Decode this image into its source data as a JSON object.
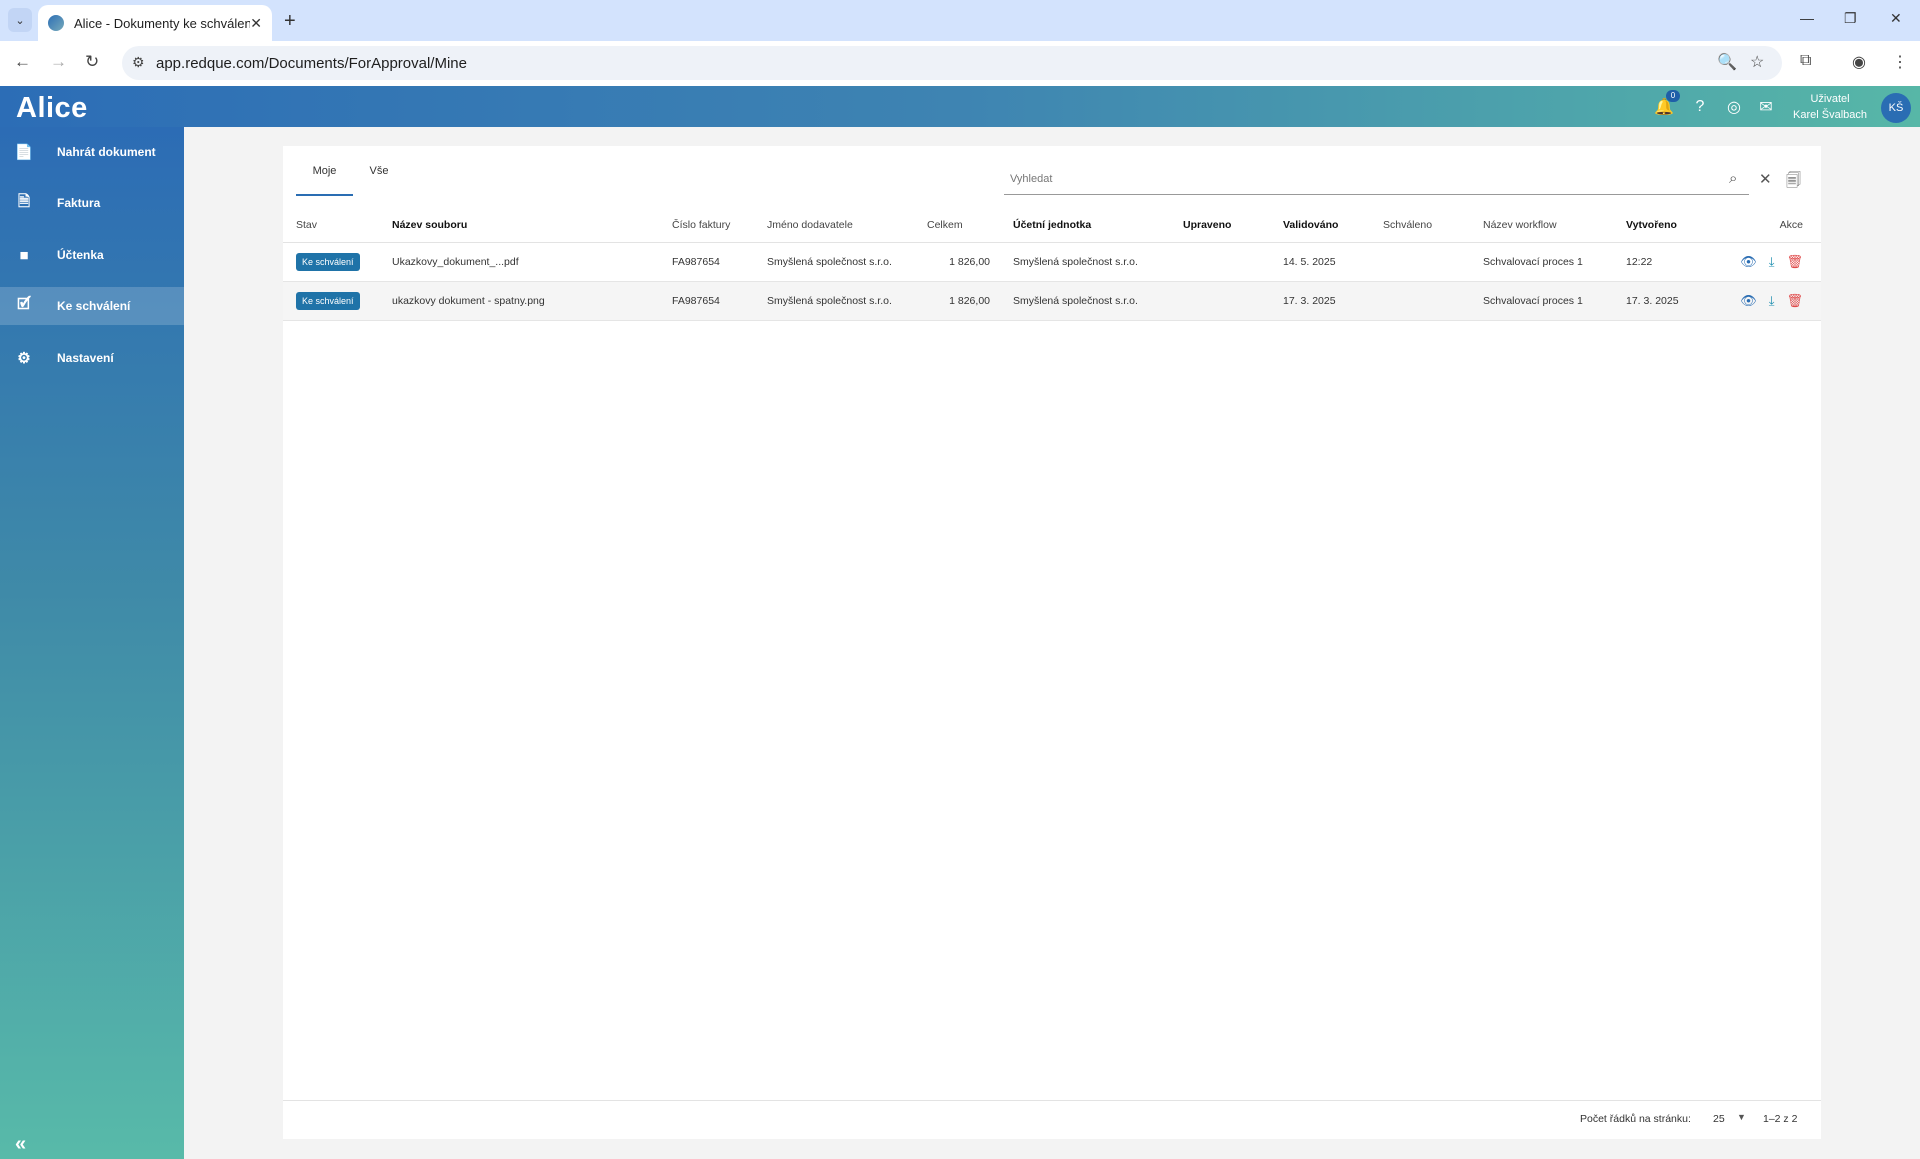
{
  "browser": {
    "tab_title": "Alice - Dokumenty ke schválení",
    "url": "app.redque.com/Documents/ForApproval/Mine"
  },
  "app": {
    "logo": "Alice",
    "notification_count": "0",
    "user_label": "Uživatel",
    "user_name": "Karel Švalbach",
    "avatar_initials": "KŠ"
  },
  "sidebar": {
    "items": [
      {
        "label": "Nahrát dokument",
        "icon": "file-upload-icon"
      },
      {
        "label": "Faktura",
        "icon": "invoice-icon"
      },
      {
        "label": "Účtenka",
        "icon": "receipt-icon"
      },
      {
        "label": "Ke schválení",
        "icon": "approval-icon"
      },
      {
        "label": "Nastavení",
        "icon": "gear-icon"
      }
    ],
    "active_index": 3
  },
  "content": {
    "tabs": [
      {
        "label": "Moje"
      },
      {
        "label": "Vše"
      }
    ],
    "active_tab": 0,
    "search_placeholder": "Vyhledat",
    "columns": [
      "Stav",
      "Název souboru",
      "Číslo faktury",
      "Jméno dodavatele",
      "Celkem",
      "Účetní jednotka",
      "Upraveno",
      "Validováno",
      "Schváleno",
      "Název workflow",
      "Vytvořeno",
      "Akce"
    ],
    "rows": [
      {
        "stav": "Ke schválení",
        "nazev": "Ukazkovy_dokument_...pdf",
        "cislo": "FA987654",
        "dodavatel": "Smyšlená společnost s.r.o.",
        "celkem": "1 826,00",
        "jednotka": "Smyšlená společnost s.r.o.",
        "upraveno": "",
        "validovano": "14. 5. 2025",
        "schvaleno": "",
        "workflow": "Schvalovací proces 1",
        "vytvoreno": "12:22"
      },
      {
        "stav": "Ke schválení",
        "nazev": "ukazkovy dokument - spatny.png",
        "cislo": "FA987654",
        "dodavatel": "Smyšlená společnost s.r.o.",
        "celkem": "1 826,00",
        "jednotka": "Smyšlená společnost s.r.o.",
        "upraveno": "",
        "validovano": "17. 3. 2025",
        "schvaleno": "",
        "workflow": "Schvalovací proces 1",
        "vytvoreno": "17. 3. 2025"
      }
    ],
    "footer": {
      "rows_per_page_label": "Počet řádků na stránku:",
      "rows_per_page_value": "25",
      "range": "1–2 z 2"
    }
  }
}
